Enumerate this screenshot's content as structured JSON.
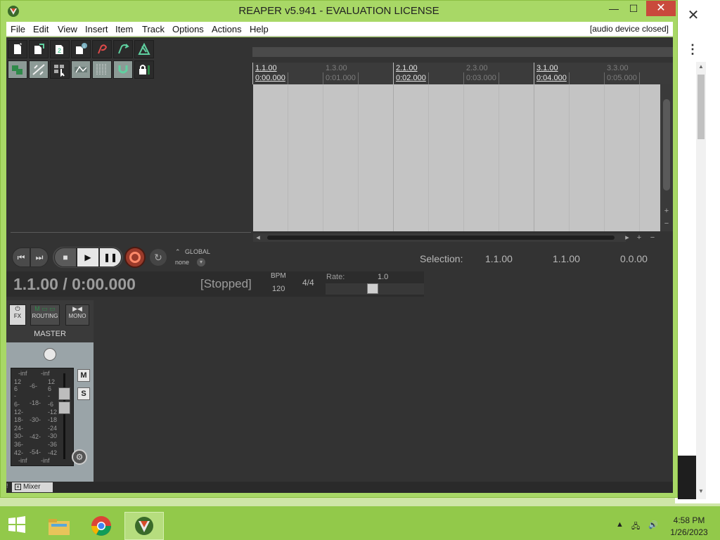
{
  "window": {
    "title": "REAPER v5.941 - EVALUATION LICENSE",
    "minimize": "—",
    "maximize": "☐",
    "close": "✕"
  },
  "menu": {
    "items": [
      "File",
      "Edit",
      "View",
      "Insert",
      "Item",
      "Track",
      "Options",
      "Actions",
      "Help"
    ],
    "audio_status": "[audio device closed]"
  },
  "ruler": {
    "marks": [
      {
        "bar": "1.1.00",
        "time": "0:00.000",
        "major": true
      },
      {
        "bar": "1.3.00",
        "time": "0:01.000",
        "major": false
      },
      {
        "bar": "2.1.00",
        "time": "0:02.000",
        "major": true
      },
      {
        "bar": "2.3.00",
        "time": "0:03.000",
        "major": false
      },
      {
        "bar": "3.1.00",
        "time": "0:04.000",
        "major": true
      },
      {
        "bar": "3.3.00",
        "time": "0:05.000",
        "major": false
      }
    ]
  },
  "transport": {
    "global_label": "GLOBAL",
    "global_mode": "none",
    "position": "1.1.00 / 0:00.000",
    "state": "[Stopped]",
    "bpm_label": "BPM",
    "bpm": "120",
    "time_signature": "4/4",
    "rate_label": "Rate:",
    "rate": "1.0",
    "rate_slider_fraction": 0.5
  },
  "selection": {
    "label": "Selection:",
    "start": "1.1.00",
    "end": "1.1.00",
    "length": "0.0.00"
  },
  "mixer": {
    "fx": "FX",
    "routing": "ROUTING",
    "mono": "MONO",
    "master": "MASTER",
    "mute": "M",
    "solo": "S",
    "peak_left": "-inf",
    "peak_right": "-inf",
    "scale_left": [
      "12",
      "6",
      "-",
      "6-",
      "12-",
      "18-",
      "24-",
      "30-",
      "36-",
      "42-"
    ],
    "scale_mid": [
      "-6-",
      "-18-",
      "-30-",
      "-42-",
      "-54-"
    ],
    "scale_right": [
      "12",
      "6",
      "-",
      "-6",
      "-12",
      "-18",
      "-24",
      "-30",
      "-36",
      "-42"
    ],
    "floor_left": "-inf",
    "floor_right": "-inf",
    "tab_label": "Mixer"
  },
  "taskbar": {
    "time": "4:58 PM",
    "date": "1/26/2023"
  },
  "colors": {
    "window_frame": "#a8d866",
    "taskbar": "#92c94a",
    "arrange_bg": "#c4c4c4",
    "record": "#9a3a2a"
  }
}
